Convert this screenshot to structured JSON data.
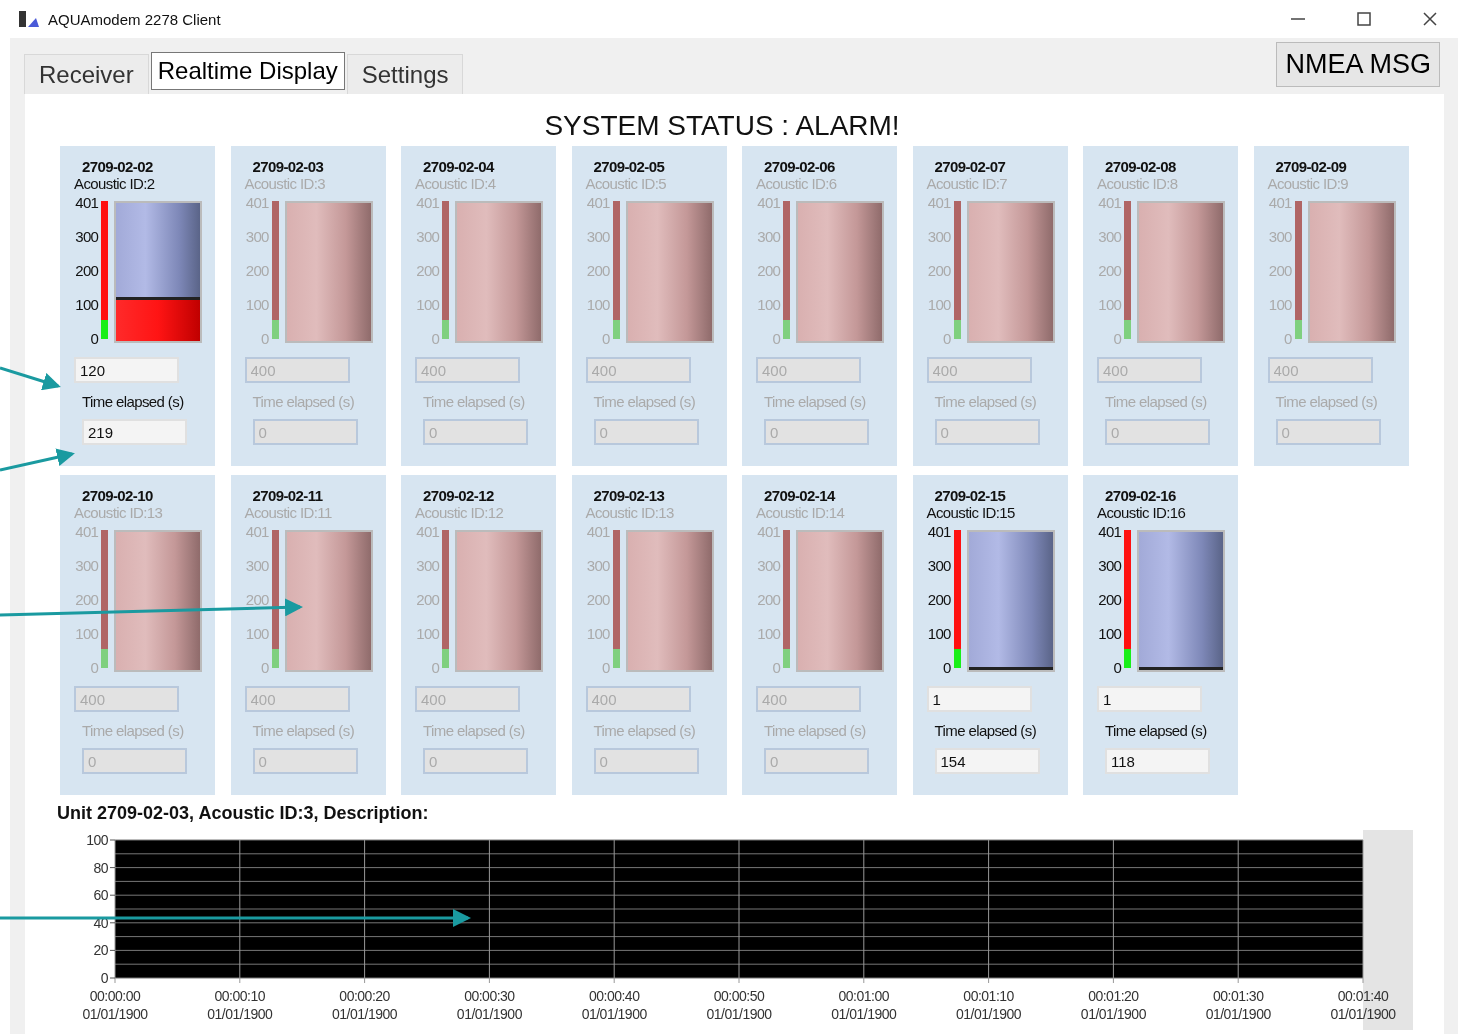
{
  "window": {
    "title": "AQUAmodem 2278 Client"
  },
  "tabs": [
    {
      "label": "Receiver",
      "selected": false
    },
    {
      "label": "Realtime Display",
      "selected": true
    },
    {
      "label": "Settings",
      "selected": false
    }
  ],
  "nmea_button": "NMEA MSG",
  "system_status": "SYSTEM STATUS : ALARM!",
  "units": [
    {
      "serial": "2709-02-02",
      "acoustic_id": "Acoustic ID:2",
      "scale": [
        "401",
        "300",
        "200",
        "100",
        "0"
      ],
      "active": true,
      "level": 0.3,
      "value": "120",
      "time_label": "Time elapsed (s)",
      "time": "219"
    },
    {
      "serial": "2709-02-03",
      "acoustic_id": "Acoustic ID:3",
      "scale": [
        "401",
        "300",
        "200",
        "100",
        "0"
      ],
      "active": false,
      "value": "400",
      "time_label": "Time elapsed (s)",
      "time": "0"
    },
    {
      "serial": "2709-02-04",
      "acoustic_id": "Acoustic ID:4",
      "scale": [
        "401",
        "300",
        "200",
        "100",
        "0"
      ],
      "active": false,
      "value": "400",
      "time_label": "Time elapsed (s)",
      "time": "0"
    },
    {
      "serial": "2709-02-05",
      "acoustic_id": "Acoustic ID:5",
      "scale": [
        "401",
        "300",
        "200",
        "100",
        "0"
      ],
      "active": false,
      "value": "400",
      "time_label": "Time elapsed (s)",
      "time": "0"
    },
    {
      "serial": "2709-02-06",
      "acoustic_id": "Acoustic ID:6",
      "scale": [
        "401",
        "300",
        "200",
        "100",
        "0"
      ],
      "active": false,
      "value": "400",
      "time_label": "Time elapsed (s)",
      "time": "0"
    },
    {
      "serial": "2709-02-07",
      "acoustic_id": "Acoustic ID:7",
      "scale": [
        "401",
        "300",
        "200",
        "100",
        "0"
      ],
      "active": false,
      "value": "400",
      "time_label": "Time elapsed (s)",
      "time": "0"
    },
    {
      "serial": "2709-02-08",
      "acoustic_id": "Acoustic ID:8",
      "scale": [
        "401",
        "300",
        "200",
        "100",
        "0"
      ],
      "active": false,
      "value": "400",
      "time_label": "Time elapsed (s)",
      "time": "0"
    },
    {
      "serial": "2709-02-09",
      "acoustic_id": "Acoustic ID:9",
      "scale": [
        "401",
        "300",
        "200",
        "100",
        "0"
      ],
      "active": false,
      "value": "400",
      "time_label": "Time elapsed (s)",
      "time": "0"
    },
    {
      "serial": "2709-02-10",
      "acoustic_id": "Acoustic ID:13",
      "scale": [
        "401",
        "300",
        "200",
        "100",
        "0"
      ],
      "active": false,
      "value": "400",
      "time_label": "Time elapsed (s)",
      "time": "0"
    },
    {
      "serial": "2709-02-11",
      "acoustic_id": "Acoustic ID:11",
      "scale": [
        "401",
        "300",
        "200",
        "100",
        "0"
      ],
      "active": false,
      "value": "400",
      "time_label": "Time elapsed (s)",
      "time": "0"
    },
    {
      "serial": "2709-02-12",
      "acoustic_id": "Acoustic ID:12",
      "scale": [
        "401",
        "300",
        "200",
        "100",
        "0"
      ],
      "active": false,
      "value": "400",
      "time_label": "Time elapsed (s)",
      "time": "0"
    },
    {
      "serial": "2709-02-13",
      "acoustic_id": "Acoustic ID:13",
      "scale": [
        "401",
        "300",
        "200",
        "100",
        "0"
      ],
      "active": false,
      "value": "400",
      "time_label": "Time elapsed (s)",
      "time": "0"
    },
    {
      "serial": "2709-02-14",
      "acoustic_id": "Acoustic ID:14",
      "scale": [
        "401",
        "300",
        "200",
        "100",
        "0"
      ],
      "active": false,
      "value": "400",
      "time_label": "Time elapsed (s)",
      "time": "0"
    },
    {
      "serial": "2709-02-15",
      "acoustic_id": "Acoustic ID:15",
      "scale": [
        "401",
        "300",
        "200",
        "100",
        "0"
      ],
      "active": true,
      "level": 0.0,
      "value": "1",
      "time_label": "Time elapsed (s)",
      "time": "154"
    },
    {
      "serial": "2709-02-16",
      "acoustic_id": "Acoustic ID:16",
      "scale": [
        "401",
        "300",
        "200",
        "100",
        "0"
      ],
      "active": true,
      "level": 0.0,
      "value": "1",
      "time_label": "Time elapsed (s)",
      "time": "118"
    }
  ],
  "detail": {
    "title": "Unit 2709-02-03, Acoustic ID:3, Description:",
    "chart_data": {
      "type": "line",
      "grid": true,
      "ylim": [
        0,
        100
      ],
      "yticks": [
        0,
        20,
        40,
        60,
        80,
        100
      ],
      "categories": [
        "00:00:00\n01/01/1900",
        "00:00:10\n01/01/1900",
        "00:00:20\n01/01/1900",
        "00:00:30\n01/01/1900",
        "00:00:40\n01/01/1900",
        "00:00:50\n01/01/1900",
        "00:01:00\n01/01/1900",
        "00:01:10\n01/01/1900",
        "00:01:20\n01/01/1900",
        "00:01:30\n01/01/1900",
        "00:01:40\n01/01/1900"
      ]
    }
  }
}
